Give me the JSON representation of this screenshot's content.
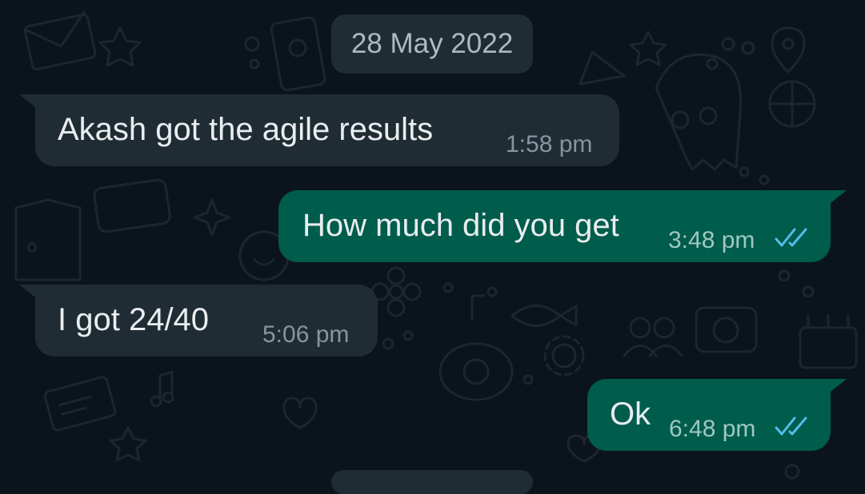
{
  "chat": {
    "date_divider": "28 May 2022",
    "messages": [
      {
        "direction": "incoming",
        "text": "Akash got the agile results",
        "time": "1:58 pm"
      },
      {
        "direction": "outgoing",
        "text": "How much did you get",
        "time": "3:48 pm",
        "status": "read-double-tick-icon"
      },
      {
        "direction": "incoming",
        "text": "I got 24/40",
        "time": "5:06 pm"
      },
      {
        "direction": "outgoing",
        "text": "Ok",
        "time": "6:48 pm",
        "status": "read-double-tick-icon"
      }
    ]
  },
  "colors": {
    "background": "#0b141a",
    "incoming_bubble": "#202c33",
    "outgoing_bubble": "#005c4b",
    "date_chip": "#1f2c33",
    "read_tick": "#53bdeb"
  }
}
